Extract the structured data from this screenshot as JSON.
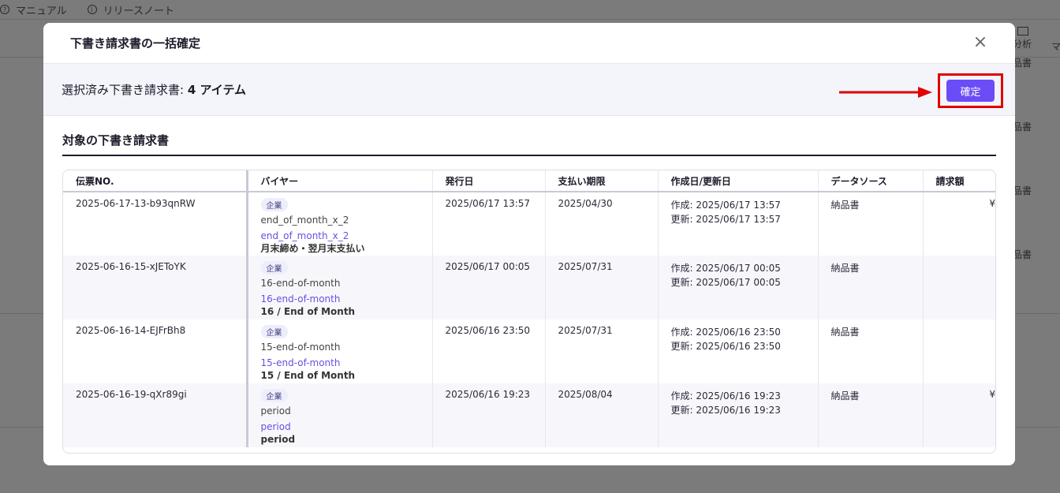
{
  "background": {
    "topbar": {
      "manual_label": "マニュアル",
      "release_label": "リリースノート"
    },
    "analysis_label": "分析",
    "ma_label": "マ",
    "row_labels": [
      "品書",
      "品書",
      "品書",
      "品書"
    ]
  },
  "modal": {
    "title": "下書き請求書の一括確定",
    "close_label": "×",
    "summary_prefix": "選択済み下書き請求書: ",
    "summary_count": "4 アイテム",
    "confirm_label": "確定",
    "section_title": "対象の下書き請求書",
    "columns": [
      "伝票NO.",
      "バイヤー",
      "発行日",
      "支払い期限",
      "作成日/更新日",
      "データソース",
      "請求額"
    ],
    "rows": [
      {
        "no": "2025-06-17-13-b93qnRW",
        "tag": "企業",
        "buyer_name": "end_of_month_x_2",
        "buyer_link": "end_of_month_x_2",
        "buyer_term": "月末締め・翌月末支払い",
        "issue_date": "2025/06/17 13:57",
        "due_date": "2025/04/30",
        "created": "作成: 2025/06/17 13:57",
        "updated": "更新: 2025/06/17 13:57",
        "source": "納品書",
        "amount": "¥"
      },
      {
        "no": "2025-06-16-15-xJEToYK",
        "tag": "企業",
        "buyer_name": "16-end-of-month",
        "buyer_link": "16-end-of-month",
        "buyer_term": "16 / End of Month",
        "issue_date": "2025/06/17 00:05",
        "due_date": "2025/07/31",
        "created": "作成: 2025/06/17 00:05",
        "updated": "更新: 2025/06/17 00:05",
        "source": "納品書",
        "amount": ""
      },
      {
        "no": "2025-06-16-14-EJFrBh8",
        "tag": "企業",
        "buyer_name": "15-end-of-month",
        "buyer_link": "15-end-of-month",
        "buyer_term": "15 / End of Month",
        "issue_date": "2025/06/16 23:50",
        "due_date": "2025/07/31",
        "created": "作成: 2025/06/16 23:50",
        "updated": "更新: 2025/06/16 23:50",
        "source": "納品書",
        "amount": ""
      },
      {
        "no": "2025-06-16-19-qXr89gi",
        "tag": "企業",
        "buyer_name": "period",
        "buyer_link": "period",
        "buyer_term": "period",
        "issue_date": "2025/06/16 19:23",
        "due_date": "2025/08/04",
        "created": "作成: 2025/06/16 19:23",
        "updated": "更新: 2025/06/16 19:23",
        "source": "納品書",
        "amount": "¥"
      }
    ]
  },
  "colors": {
    "accent": "#6b4cf6",
    "highlight": "#e00000",
    "link": "#6a4fe0"
  }
}
